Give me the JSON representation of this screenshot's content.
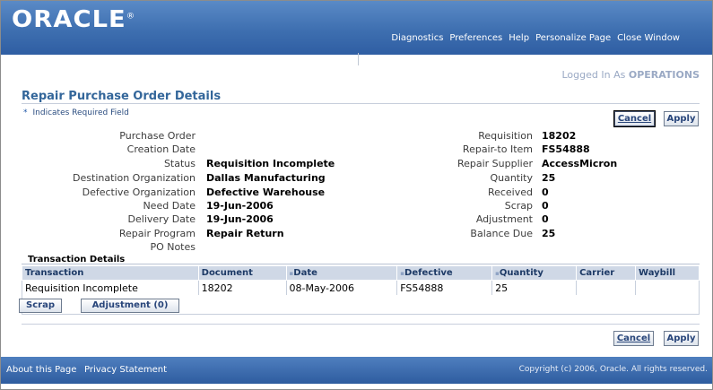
{
  "header": {
    "logo_text": "ORACLE",
    "logo_mark": "®",
    "global_links": [
      "Diagnostics",
      "Preferences",
      "Help",
      "Personalize Page",
      "Close Window"
    ]
  },
  "user": {
    "prefix": "Logged In As",
    "name": "OPERATIONS"
  },
  "page": {
    "title": "Repair Purchase Order Details",
    "required_star": "*",
    "required_note": "Indicates Required Field"
  },
  "buttons": {
    "cancel": "Cancel",
    "apply": "Apply",
    "scrap": "Scrap",
    "adjustment": "Adjustment (0)"
  },
  "left_fields": [
    {
      "label": "Purchase Order",
      "value": ""
    },
    {
      "label": "Creation Date",
      "value": ""
    },
    {
      "label": "Status",
      "value": "Requisition Incomplete"
    },
    {
      "label": "Destination Organization",
      "value": "Dallas Manufacturing"
    },
    {
      "label": "Defective Organization",
      "value": "Defective Warehouse"
    },
    {
      "label": "Need Date",
      "value": "19-Jun-2006"
    },
    {
      "label": "Delivery Date",
      "value": "19-Jun-2006"
    },
    {
      "label": "Repair Program",
      "value": "Repair Return"
    },
    {
      "label": "PO Notes",
      "value": ""
    }
  ],
  "right_fields": [
    {
      "label": "Requisition",
      "value": "18202"
    },
    {
      "label": "Repair-to Item",
      "value": "FS54888"
    },
    {
      "label": "Repair Supplier",
      "value": "AccessMicron"
    },
    {
      "label": "Quantity",
      "value": "25"
    },
    {
      "label": "Received",
      "value": "0"
    },
    {
      "label": "Scrap",
      "value": "0"
    },
    {
      "label": "Adjustment",
      "value": "0"
    },
    {
      "label": "Balance Due",
      "value": "25"
    }
  ],
  "transactions": {
    "title": "Transaction Details",
    "sort_glyph": "▪",
    "columns": [
      "Transaction",
      "Document",
      "Date",
      "Defective",
      "Quantity",
      "Carrier",
      "Waybill"
    ],
    "rows": [
      [
        "Requisition Incomplete",
        "18202",
        "08-May-2006",
        "FS54888",
        "25",
        "",
        ""
      ]
    ]
  },
  "footer": {
    "links": [
      "About this Page",
      "Privacy Statement"
    ],
    "copyright": "Copyright (c) 2006, Oracle. All rights reserved."
  }
}
